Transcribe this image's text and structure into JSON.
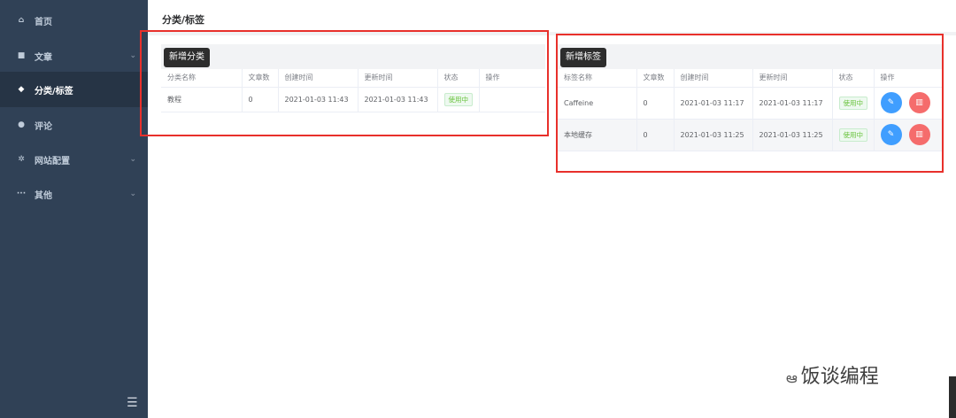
{
  "sidebar": {
    "items": [
      {
        "icon": "home-icon",
        "glyph": "⌂",
        "label": "首页",
        "has_children": false,
        "active": false
      },
      {
        "icon": "document-icon",
        "glyph": "■",
        "label": "文章",
        "has_children": true,
        "active": false
      },
      {
        "icon": "tag-icon",
        "glyph": "◆",
        "label": "分类/标签",
        "has_children": false,
        "active": true
      },
      {
        "icon": "comment-icon",
        "glyph": "●",
        "label": "评论",
        "has_children": false,
        "active": false
      },
      {
        "icon": "settings-icon",
        "glyph": "✲",
        "label": "网站配置",
        "has_children": true,
        "active": false
      },
      {
        "icon": "more-icon",
        "glyph": "···",
        "label": "其他",
        "has_children": true,
        "active": false
      }
    ],
    "toggle_glyph": "☰"
  },
  "header": {
    "title": "分类/标签"
  },
  "category_panel": {
    "add_button": "新增分类",
    "columns": [
      "分类名称",
      "文章数",
      "创建时间",
      "更新时间",
      "状态",
      "操作"
    ],
    "rows": [
      {
        "name": "教程",
        "count": "0",
        "created": "2021-01-03 11:43",
        "updated": "2021-01-03 11:43",
        "status": "使用中"
      }
    ]
  },
  "tag_panel": {
    "add_button": "新增标签",
    "columns": [
      "标签名称",
      "文章数",
      "创建时间",
      "更新时间",
      "状态",
      "操作"
    ],
    "rows": [
      {
        "name": "Caffeine",
        "count": "0",
        "created": "2021-01-03 11:17",
        "updated": "2021-01-03 11:17",
        "status": "使用中"
      },
      {
        "name": "本地缓存",
        "count": "0",
        "created": "2021-01-03 11:25",
        "updated": "2021-01-03 11:25",
        "status": "使用中"
      }
    ]
  },
  "watermark": {
    "text": "饭谈编程"
  },
  "colors": {
    "sidebar_bg": "#304156",
    "sidebar_active": "#263445",
    "status_green": "#67c23a",
    "edit_blue": "#409eff",
    "delete_red": "#f56c6c",
    "highlight_red": "#e8302b"
  }
}
